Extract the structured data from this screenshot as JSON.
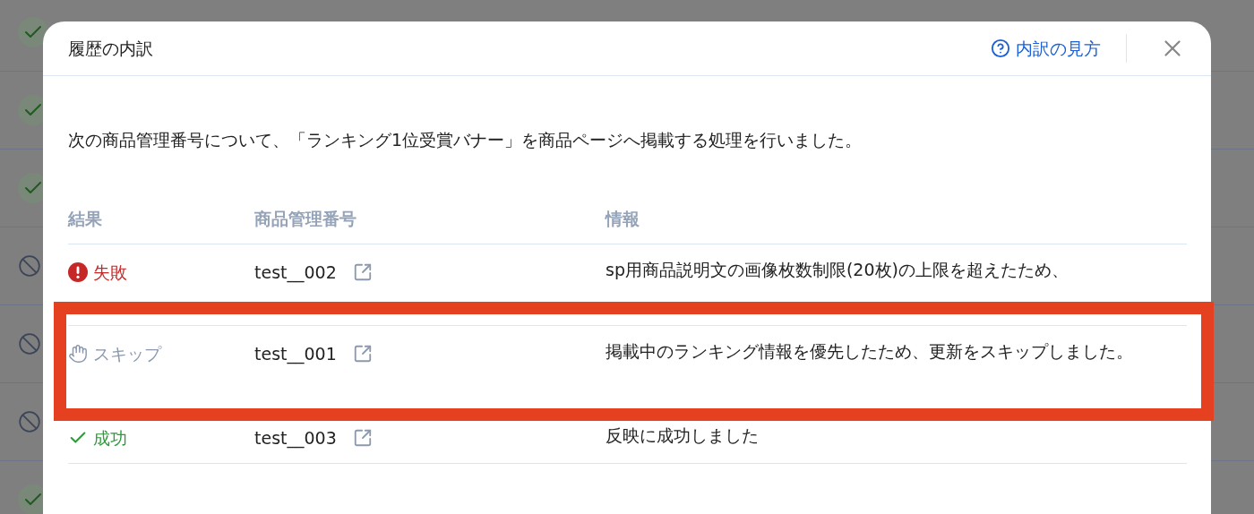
{
  "background_list": [
    {
      "kind": "success"
    },
    {
      "kind": "success"
    },
    {
      "kind": "success"
    },
    {
      "kind": "skip"
    },
    {
      "kind": "skip"
    },
    {
      "kind": "skip"
    },
    {
      "kind": "success"
    }
  ],
  "dialog": {
    "title": "履歴の内訳",
    "help_link": "内訳の見方",
    "message": "次の商品管理番号について、「ランキング1位受賞バナー」を商品ページへ掲載する処理を行いました。",
    "table": {
      "columns": [
        "結果",
        "商品管理番号",
        "情報"
      ],
      "rows": [
        {
          "result": {
            "kind": "failure",
            "label": "失敗"
          },
          "id": "test__002",
          "info": "sp用商品説明文の画像枚数制限(20枚)の上限を超えたため、"
        },
        {
          "result": {
            "kind": "skip",
            "label": "スキップ"
          },
          "id": "test__001",
          "info": "掲載中のランキング情報を優先したため、更新をスキップしました。"
        },
        {
          "result": {
            "kind": "success",
            "label": "成功"
          },
          "id": "test__003",
          "info": "反映に成功しました"
        }
      ]
    }
  }
}
